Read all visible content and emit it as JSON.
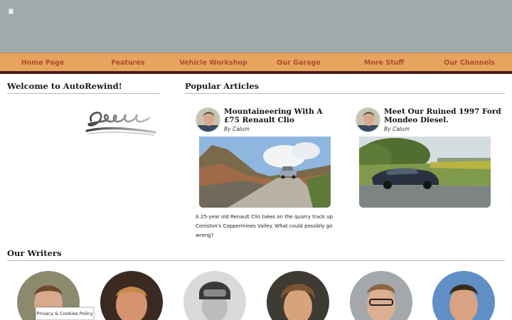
{
  "header": {
    "logo_alt": "",
    "band_color": "#9faaad"
  },
  "nav": {
    "items": [
      {
        "label": "Home Page"
      },
      {
        "label": "Features"
      },
      {
        "label": "Vehicle Workshop"
      },
      {
        "label": "Our Garage"
      },
      {
        "label": "More Stuff"
      },
      {
        "label": "Our Channels"
      }
    ],
    "bg_color": "#e6a45f",
    "text_color": "#b04a2f"
  },
  "welcome": {
    "title": "Welcome to AutoRewind!"
  },
  "popular": {
    "title": "Popular Articles",
    "articles": [
      {
        "title": "Mountaineering With A £75 Renault Clio",
        "author": "By Calum",
        "description": "A 25-year old Renault Clio takes on the quarry track up Coniston's Coppermines Valley. What could possibly go wrong?"
      },
      {
        "title": "Meet Our Ruined 1997 Ford Mondeo Diesel.",
        "author": "By Calum",
        "description": ""
      }
    ]
  },
  "writers": {
    "title": "Our Writers",
    "count": 6
  },
  "cookie": {
    "label": "Privacy & Cookies Policy"
  }
}
